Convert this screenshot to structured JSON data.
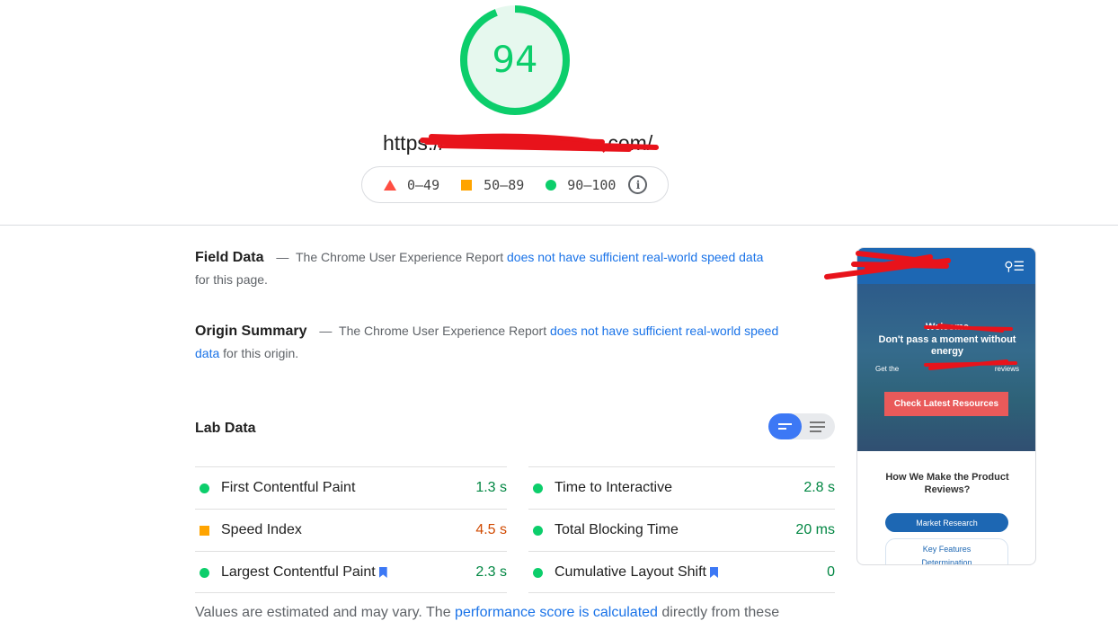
{
  "score": {
    "value": "94",
    "fraction": 0.94,
    "color": "#0cce6b"
  },
  "url": {
    "visible_text": "https://",
    "visible_tail": ".com/"
  },
  "legend": [
    {
      "range": "0–49",
      "icon": "triangle-fail-icon",
      "color": "#ff4e42"
    },
    {
      "range": "50–89",
      "icon": "square-average-icon",
      "color": "#ffa400"
    },
    {
      "range": "90–100",
      "icon": "circle-pass-icon",
      "color": "#0cce6b"
    }
  ],
  "field": {
    "title": "Field Data",
    "dash": "—",
    "prefix": "The Chrome User Experience Report",
    "link": "does not have sufficient real-world speed data",
    "suffix": "for this page."
  },
  "origin": {
    "title": "Origin Summary",
    "dash": "—",
    "prefix": "The Chrome User Experience Report",
    "link": "does not have sufficient real-world speed data",
    "suffix": "for this origin."
  },
  "lab": {
    "title": "Lab Data",
    "metrics": [
      {
        "name": "First Contentful Paint",
        "value": "1.3 s",
        "status": "pass"
      },
      {
        "name": "Time to Interactive",
        "value": "2.8 s",
        "status": "pass"
      },
      {
        "name": "Speed Index",
        "value": "4.5 s",
        "status": "average"
      },
      {
        "name": "Total Blocking Time",
        "value": "20 ms",
        "status": "pass"
      },
      {
        "name": "Largest Contentful Paint",
        "value": "2.3 s",
        "status": "pass"
      },
      {
        "name": "Cumulative Layout Shift",
        "value": "0",
        "status": "pass"
      }
    ]
  },
  "footnote": {
    "prefix": "Values are estimated and may vary. The",
    "link": "performance score is calculated",
    "suffix": "directly from these"
  },
  "thumbnail": {
    "hero_line1": "Welcome",
    "hero_line2": "Don't pass a moment without",
    "hero_line3": "energy",
    "hero_small": "Get the",
    "hero_small_tail": "reviews",
    "cta": "Check Latest Resources",
    "heading_line1": "How We Make the Product",
    "heading_line2": "Reviews?",
    "pill1": "Market Research",
    "pill2_line1": "Key Features",
    "pill2_line2": "Determination"
  }
}
